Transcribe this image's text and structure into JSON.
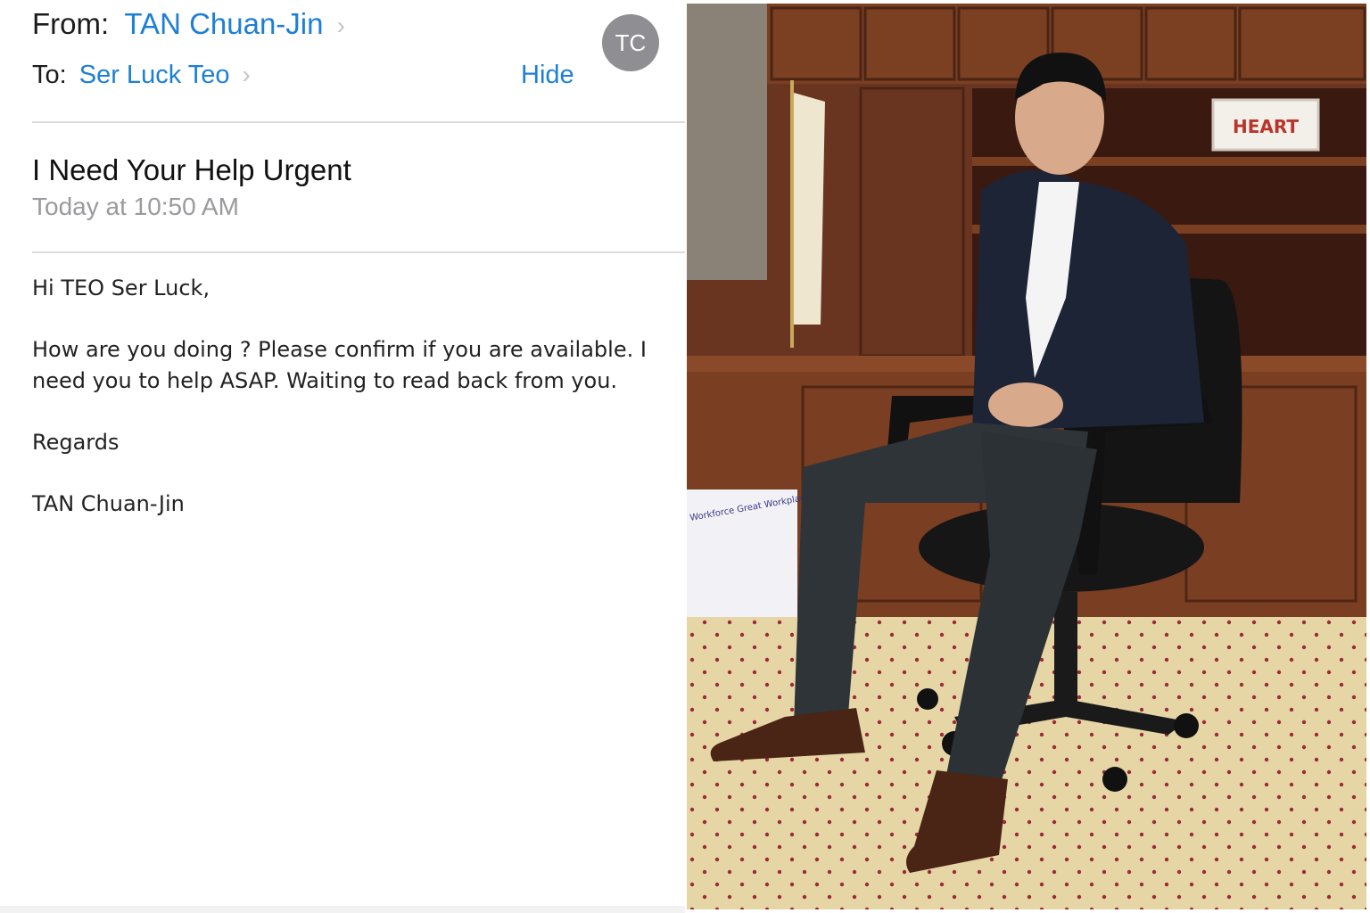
{
  "email": {
    "from_label": "From:",
    "from_name": "TAN Chuan-Jin",
    "to_label": "To:",
    "to_name": "Ser Luck Teo",
    "hide_label": "Hide",
    "avatar_initials": "TC",
    "chevron": "›",
    "subject": "I Need Your Help Urgent",
    "date": "Today at 10:50 AM",
    "body": {
      "greeting": "Hi TEO Ser Luck,",
      "message": "How are you doing ? Please confirm if you are available. I need you to help ASAP. Waiting to read back from you.",
      "closing": "Regards",
      "signature": "TAN Chuan-Jin"
    }
  },
  "photo": {
    "sign_text": "HEART",
    "poster_text": "Workforce Great Workplace"
  },
  "colors": {
    "link": "#1e7fd6",
    "avatar_bg": "#8e8e93",
    "wood": "#7a3e22",
    "carpet": "#e6d6a6"
  }
}
